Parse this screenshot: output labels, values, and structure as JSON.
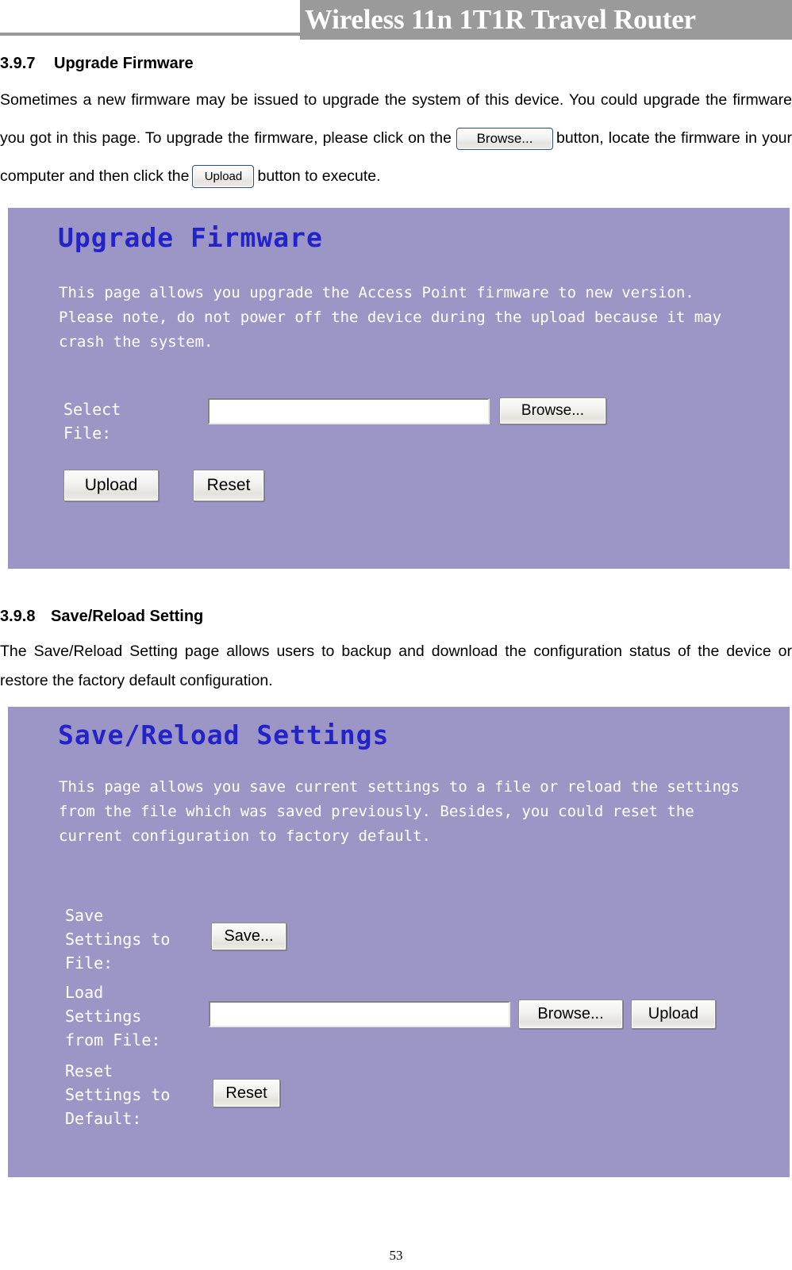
{
  "header": {
    "title": "Wireless 11n 1T1R Travel Router"
  },
  "sections": [
    {
      "number": "3.9.7",
      "title": "Upgrade Firmware",
      "paragraph_part1": "Sometimes a new firmware may be issued to upgrade the system of this device. You could upgrade the firmware you got in this page. To upgrade the firmware, please click on the",
      "inline_browse_label": "Browse...",
      "paragraph_part2": "button, locate the firmware in your computer and then click the",
      "inline_upload_label": "Upload",
      "paragraph_part3": "button to execute."
    },
    {
      "number": "3.9.8",
      "title": "Save/Reload Setting",
      "paragraph": "The Save/Reload Setting page allows users to backup and download the configuration status of the device or restore the factory default configuration."
    }
  ],
  "screenshot_upgrade": {
    "title": "Upgrade Firmware",
    "description": "This page allows you upgrade the Access Point firmware to new version. Please note, do not power off the device during the upload because it may crash the system.",
    "select_file_label": "Select\nFile:",
    "file_input_value": "",
    "browse_button": "Browse...",
    "upload_button": "Upload",
    "reset_button": "Reset",
    "bg_color": "#9b96c6",
    "title_color": "#2323c8"
  },
  "screenshot_savereload": {
    "title": "Save/Reload Settings",
    "description": "This page allows you save current settings to a file or reload the settings from the file which was saved previously. Besides, you could reset the current configuration to factory default.",
    "save_settings_label": "Save\nSettings to\nFile:",
    "save_button": "Save...",
    "load_settings_label": "Load\nSettings\nfrom File:",
    "load_input_value": "",
    "browse_button": "Browse...",
    "upload_button": "Upload",
    "reset_settings_label": "Reset\nSettings to\nDefault:",
    "reset_button": "Reset",
    "bg_color": "#9b96c6",
    "title_color": "#2323c8"
  },
  "footer": {
    "page_number": "53"
  }
}
